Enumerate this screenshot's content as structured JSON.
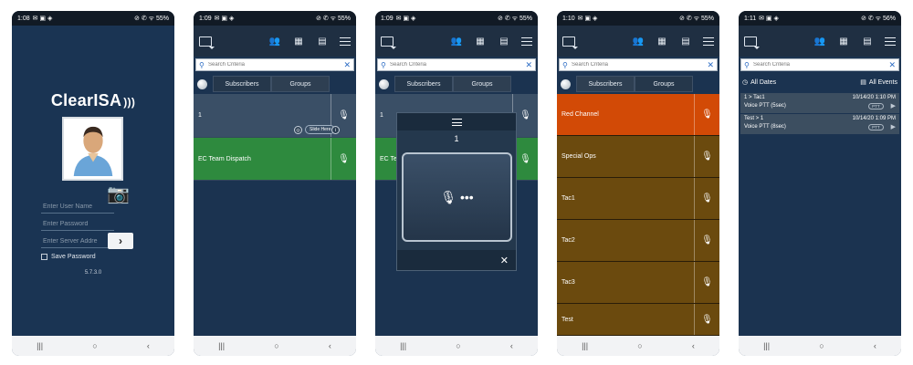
{
  "status": [
    {
      "time": "1:08",
      "icons": "✉ ▣ ◈",
      "right": "⊘ ✆ ᯤ 55%"
    },
    {
      "time": "1:09",
      "icons": "✉ ▣ ◈",
      "right": "⊘ ✆ ᯤ 55%"
    },
    {
      "time": "1:09",
      "icons": "✉ ▣ ◈",
      "right": "⊘ ✆ ᯤ 55%"
    },
    {
      "time": "1:10",
      "icons": "✉ ▣ ◈",
      "right": "⊘ ✆ ᯤ 55%"
    },
    {
      "time": "1:11",
      "icons": "✉ ▣ ◈",
      "right": "⊘ ✆ ᯤ 56%"
    }
  ],
  "nav": {
    "recents": "|||",
    "home": "○",
    "back": "‹"
  },
  "login": {
    "logo": "ClearISA",
    "username_placeholder": "Enter User Name",
    "password_placeholder": "Enter Password",
    "server_placeholder": "Enter Server Addre",
    "go_label": "›",
    "save_password": "Save Password",
    "version": "5.7.3.0"
  },
  "search": {
    "placeholder": "Search Criteria"
  },
  "tabs": {
    "subscribers": "Subscribers",
    "groups": "Groups"
  },
  "subscribers": {
    "items": [
      {
        "label": "1",
        "color": "#3a4f66"
      },
      {
        "label": "EC Team Dispatch",
        "color": "#2e8a3e"
      }
    ],
    "slide_here": "Slide Here",
    "circle_1": "i"
  },
  "ptt": {
    "target": "1",
    "icon": "🎙 •••",
    "close": "✕",
    "bg_items": [
      {
        "label": "1",
        "color": "#3a4f66"
      },
      {
        "label": "EC Team",
        "color": "#2e8a3e"
      }
    ]
  },
  "groups": {
    "items": [
      {
        "label": "Red Channel",
        "color": "#d24a06"
      },
      {
        "label": "Special Ops",
        "color": "#6b4a0e"
      },
      {
        "label": "Tac1",
        "color": "#6b4a0e"
      },
      {
        "label": "Tac2",
        "color": "#6b4a0e"
      },
      {
        "label": "Tac3",
        "color": "#6b4a0e"
      },
      {
        "label": "Test",
        "color": "#6b4a0e"
      }
    ]
  },
  "events": {
    "date_filter": "All Dates",
    "event_filter": "All Events",
    "items": [
      {
        "route": "1 > Tac1",
        "timestamp": "10/14/20 1:10 PM",
        "desc": "Voice PTT (5sec)",
        "badge": "PTT"
      },
      {
        "route": "Test > 1",
        "timestamp": "10/14/20 1:09 PM",
        "desc": "Voice PTT (8sec)",
        "badge": "PTT"
      }
    ]
  },
  "icons": {
    "mic": "🎙",
    "search": "⚲",
    "clear": "✕",
    "camera": "📷"
  }
}
